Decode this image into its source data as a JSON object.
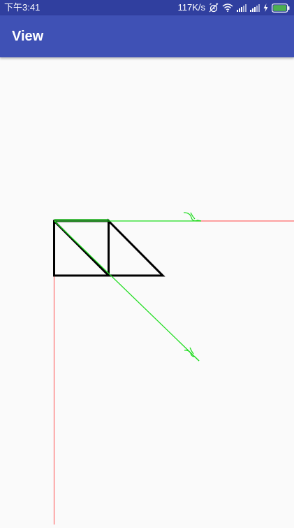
{
  "status_bar": {
    "time": "下午3:41",
    "network_speed": "117K/s",
    "icons": [
      "alarm-off-icon",
      "wifi-icon",
      "signal-icon",
      "signal-icon",
      "charging-icon",
      "battery-icon"
    ],
    "battery_color": "#4caf50"
  },
  "app_bar": {
    "title": "View",
    "color": "#3f51b5"
  },
  "canvas": {
    "background": "#fafafa",
    "shape_stroke_color": "#000000",
    "guide_line_color": "#ff6b6b",
    "vector_color": "#22dd22"
  }
}
